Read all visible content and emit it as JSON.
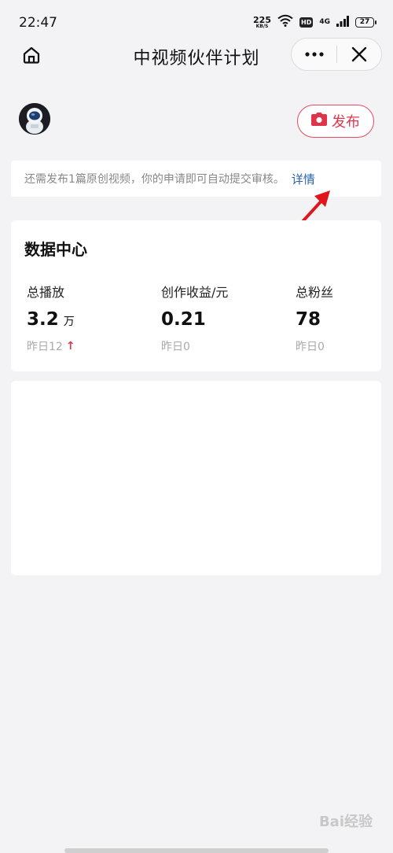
{
  "status_bar": {
    "time": "22:47",
    "net_speed_value": "225",
    "net_speed_unit": "KB/S",
    "hd": "HD",
    "network": "4G",
    "battery": "27",
    "icons": [
      "wifi-icon",
      "signal-icon",
      "battery-icon"
    ]
  },
  "nav": {
    "title": "中视频伙伴计划",
    "home_icon": "home-icon",
    "more_icon": "more-icon",
    "close_icon": "close-icon"
  },
  "profile": {
    "publish_label": "发布",
    "publish_icon": "camera-icon"
  },
  "notice": {
    "text": "还需发布1篇原创视频，你的申请即可自动提交审核。",
    "link": "详情"
  },
  "data_center": {
    "title": "数据中心",
    "stats": [
      {
        "label": "总播放",
        "value": "3.2",
        "unit": "万",
        "yesterday": "昨日12",
        "trend": "up"
      },
      {
        "label": "创作收益/元",
        "value": "0.21",
        "unit": "",
        "yesterday": "昨日0",
        "trend": ""
      },
      {
        "label": "总粉丝",
        "value": "78",
        "unit": "",
        "yesterday": "昨日0",
        "trend": ""
      }
    ]
  },
  "watermark": "Bai经验",
  "colors": {
    "accent_red": "#e0344a",
    "link_blue": "#2a63a8",
    "background": "#f3f3f5"
  }
}
